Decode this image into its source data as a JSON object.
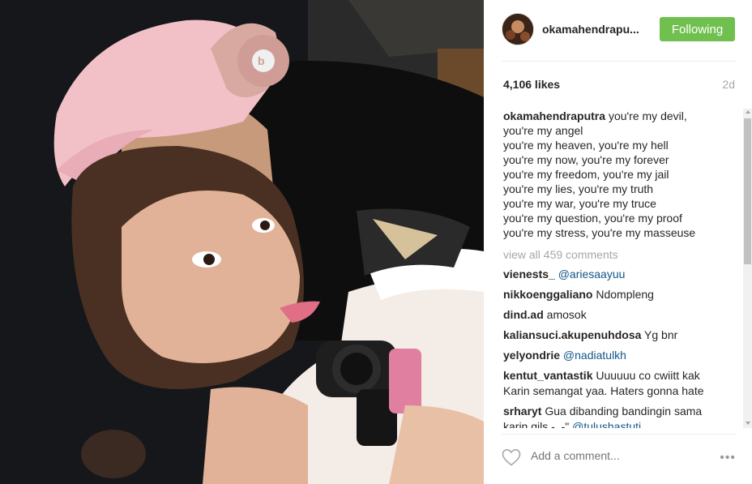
{
  "post": {
    "username": "okamahendrapu...",
    "follow_label": "Following",
    "likes": "4,106 likes",
    "age": "2d"
  },
  "caption": {
    "user": "okamahendraputra",
    "first_line": "you're my devil,",
    "lines": [
      "you're my angel",
      "you're my heaven, you're my hell",
      "you're my now, you're my forever",
      "you're my freedom, you're my jail",
      "you're my lies, you're my truth",
      "you're my war, you're my truce",
      "you're my question, you're my proof",
      "you're my stress, you're my masseuse"
    ]
  },
  "view_all": "view all 459 comments",
  "comments": [
    {
      "user": "vienests_",
      "text": "",
      "mention": "@ariesaayuu"
    },
    {
      "user": "nikkoenggaliano",
      "text": "Ndompleng",
      "mention": ""
    },
    {
      "user": "dind.ad",
      "text": "amosok",
      "mention": ""
    },
    {
      "user": "kaliansuci.akupenuhdosa",
      "text": "Yg bnr",
      "mention": ""
    },
    {
      "user": "yelyondrie",
      "text": "",
      "mention": "@nadiatulkh"
    },
    {
      "user": "kentut_vantastik",
      "text": "Uuuuuu co cwiitt kak Karin semangat yaa. Haters gonna hate",
      "mention": ""
    },
    {
      "user": "srharyt",
      "text": "Gua dibanding bandingin sama karin gils -_-\"",
      "mention": "@tulushastuti"
    }
  ],
  "footer": {
    "add_comment_placeholder": "Add a comment...",
    "more_label": "•••"
  },
  "colors": {
    "follow_button": "#70c050",
    "mention": "#125688",
    "muted": "#a5a7aa"
  },
  "icons": {
    "like": "heart-outline-icon",
    "more": "ellipsis-icon"
  }
}
